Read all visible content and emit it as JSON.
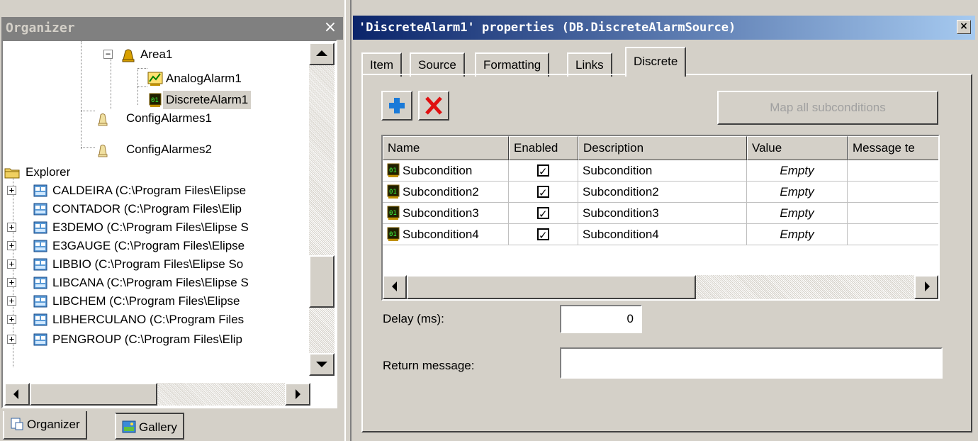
{
  "organizer": {
    "title": "Organizer",
    "close_glyph": "×",
    "tree": [
      {
        "label": "Area1",
        "icon": "area-bell-icon",
        "expander": "−"
      },
      {
        "label": "AnalogAlarm1",
        "icon": "analog-alarm-icon"
      },
      {
        "label": "DiscreteAlarm1",
        "icon": "discrete-alarm-icon",
        "selected": true
      },
      {
        "label": "ConfigAlarmes1",
        "icon": "config-bell-icon"
      },
      {
        "label": "ConfigAlarmes2",
        "icon": "config-bell-icon"
      },
      {
        "label": "Explorer",
        "icon": "folder-icon"
      },
      {
        "label": "CALDEIRA (C:\\Program Files\\Elipse",
        "icon": "project-icon",
        "expander": "+"
      },
      {
        "label": "CONTADOR (C:\\Program Files\\Elip",
        "icon": "project-icon"
      },
      {
        "label": "E3DEMO (C:\\Program Files\\Elipse S",
        "icon": "project-icon",
        "expander": "+"
      },
      {
        "label": "E3GAUGE (C:\\Program Files\\Elipse",
        "icon": "project-icon",
        "expander": "+"
      },
      {
        "label": "LIBBIO (C:\\Program Files\\Elipse So",
        "icon": "project-icon",
        "expander": "+"
      },
      {
        "label": "LIBCANA (C:\\Program Files\\Elipse S",
        "icon": "project-icon",
        "expander": "+"
      },
      {
        "label": "LIBCHEM (C:\\Program Files\\Elipse",
        "icon": "project-icon",
        "expander": "+"
      },
      {
        "label": "LIBHERCULANO (C:\\Program Files",
        "icon": "project-icon",
        "expander": "+"
      },
      {
        "label": "PENGROUP (C:\\Program Files\\Elip",
        "icon": "project-icon",
        "expander": "+"
      }
    ],
    "tabs": [
      {
        "label": "Organizer",
        "icon": "organizer-icon"
      },
      {
        "label": "Gallery",
        "icon": "gallery-icon"
      }
    ]
  },
  "props": {
    "title": "'DiscreteAlarm1' properties (DB.DiscreteAlarmSource)",
    "close_glyph": "×",
    "tabs": [
      "Item",
      "Source",
      "Formatting",
      "Links",
      "Discrete"
    ],
    "active_tab": "Discrete",
    "map_all_label": "Map all subconditions",
    "columns": [
      "Name",
      "Enabled",
      "Description",
      "Value",
      "Message te"
    ],
    "rows": [
      {
        "name": "Subcondition",
        "enabled": true,
        "description": "Subcondition",
        "value": "Empty",
        "message": ""
      },
      {
        "name": "Subcondition2",
        "enabled": true,
        "description": "Subcondition2",
        "value": "Empty",
        "message": ""
      },
      {
        "name": "Subcondition3",
        "enabled": true,
        "description": "Subcondition3",
        "value": "Empty",
        "message": ""
      },
      {
        "name": "Subcondition4",
        "enabled": true,
        "description": "Subcondition4",
        "value": "Empty",
        "message": ""
      }
    ],
    "delay_label": "Delay (ms):",
    "delay_value": "0",
    "return_label": "Return message:",
    "return_value": ""
  },
  "colors": {
    "title_active": "#0a246a",
    "title_gradient_end": "#a6caf0",
    "title_inactive": "#808080",
    "face": "#d4d0c8"
  }
}
